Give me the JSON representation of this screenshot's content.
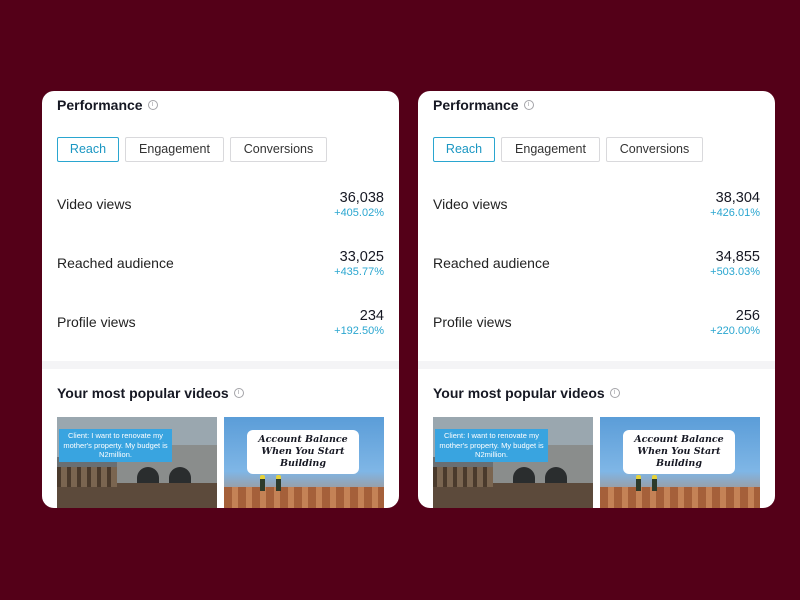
{
  "panels": [
    {
      "performance_title": "Performance",
      "tabs": [
        "Reach",
        "Engagement",
        "Conversions"
      ],
      "metrics": [
        {
          "label": "Video views",
          "value": "36,038",
          "change": "+405.02%"
        },
        {
          "label": "Reached audience",
          "value": "33,025",
          "change": "+435.77%"
        },
        {
          "label": "Profile views",
          "value": "234",
          "change": "+192.50%"
        }
      ],
      "popular_title": "Your most popular videos",
      "videos": [
        {
          "caption": "Client: I want to renovate my mother's property. My budget is N2million."
        },
        {
          "caption": "Account Balance When You Start Building"
        }
      ]
    },
    {
      "performance_title": "Performance",
      "tabs": [
        "Reach",
        "Engagement",
        "Conversions"
      ],
      "metrics": [
        {
          "label": "Video views",
          "value": "38,304",
          "change": "+426.01%"
        },
        {
          "label": "Reached audience",
          "value": "34,855",
          "change": "+503.03%"
        },
        {
          "label": "Profile views",
          "value": "256",
          "change": "+220.00%"
        }
      ],
      "popular_title": "Your most popular videos",
      "videos": [
        {
          "caption": "Client: I want to renovate my mother's property. My budget is N2million."
        },
        {
          "caption": "Account Balance When You Start Building"
        }
      ]
    }
  ],
  "colors": {
    "background": "#540018",
    "accent": "#2aa6d0"
  },
  "icons": {
    "info": "info-icon"
  }
}
